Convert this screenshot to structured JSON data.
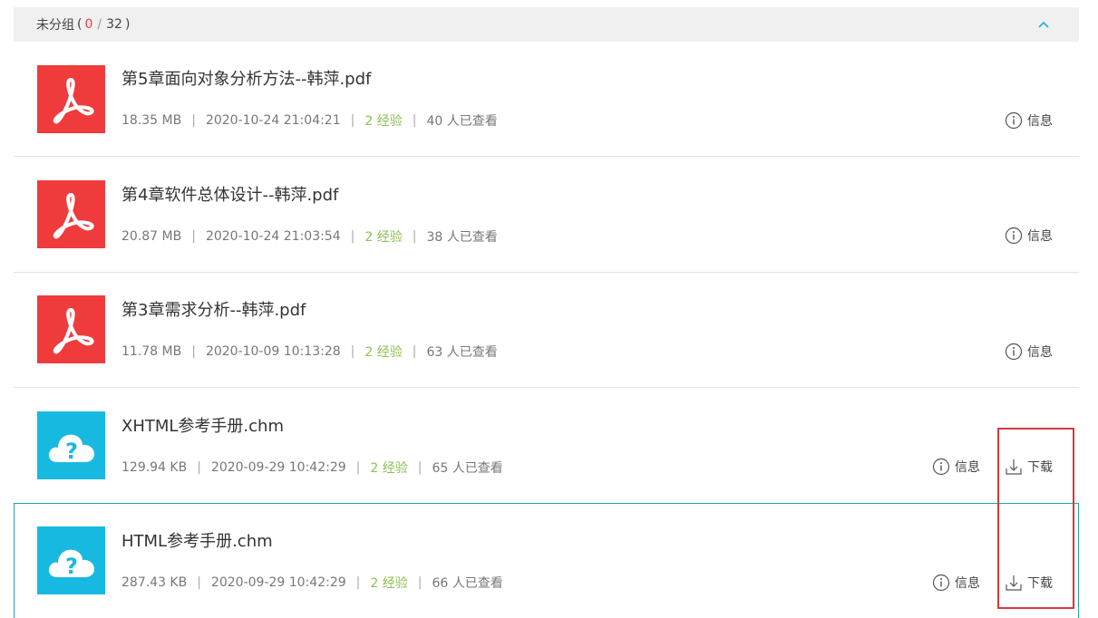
{
  "group": {
    "label": "未分组",
    "paren_open": "(",
    "count_current": "0",
    "count_sep": "/",
    "count_total": "32",
    "paren_close": ")"
  },
  "files": [
    {
      "icon": "pdf-icon",
      "name": "第5章面向对象分析方法--韩萍.pdf",
      "size": "18.35 MB",
      "date": "2020-10-24 21:04:21",
      "exp": "2 经验",
      "views": "40 人已查看",
      "info_label": "信息"
    },
    {
      "icon": "pdf-icon",
      "name": "第4章软件总体设计--韩萍.pdf",
      "size": "20.87 MB",
      "date": "2020-10-24 21:03:54",
      "exp": "2 经验",
      "views": "38 人已查看",
      "info_label": "信息"
    },
    {
      "icon": "pdf-icon",
      "name": "第3章需求分析--韩萍.pdf",
      "size": "11.78 MB",
      "date": "2020-10-09 10:13:28",
      "exp": "2 经验",
      "views": "63 人已查看",
      "info_label": "信息"
    },
    {
      "icon": "chm-help-icon",
      "name": "XHTML参考手册.chm",
      "size": "129.94 KB",
      "date": "2020-09-29 10:42:29",
      "exp": "2 经验",
      "views": "65 人已查看",
      "info_label": "信息",
      "download_label": "下载"
    },
    {
      "icon": "chm-help-icon",
      "name": "HTML参考手册.chm",
      "size": "287.43 KB",
      "date": "2020-09-29 10:42:29",
      "exp": "2 经验",
      "views": "66 人已查看",
      "info_label": "信息",
      "download_label": "下载"
    }
  ],
  "meta_separator": "|",
  "colors": {
    "pdf_tile": "#ef3b3b",
    "chm_tile": "#17b9e0",
    "experience": "#8cc152",
    "count_current": "#e83e3e",
    "selected_border": "#1fa89e",
    "highlight": "#d9363e"
  }
}
